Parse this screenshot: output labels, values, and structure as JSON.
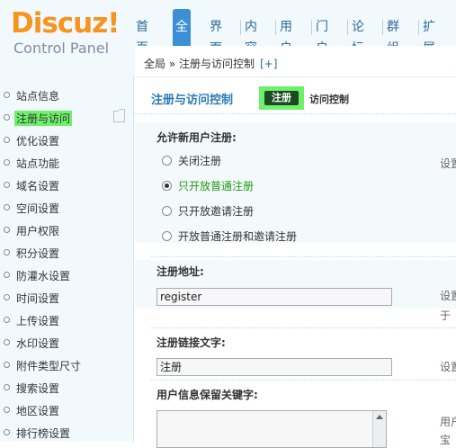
{
  "logo": {
    "main": "Discuz!",
    "sub": "Control Panel"
  },
  "topnav": [
    {
      "label": "首页",
      "active": false
    },
    {
      "label": "全局",
      "active": true
    },
    {
      "label": "界面",
      "active": false
    },
    {
      "label": "内容",
      "active": false
    },
    {
      "label": "用户",
      "active": false
    },
    {
      "label": "门户",
      "active": false
    },
    {
      "label": "论坛",
      "active": false
    },
    {
      "label": "群组",
      "active": false
    },
    {
      "label": "扩展",
      "active": false
    }
  ],
  "breadcrumb": {
    "text": "全局 » 注册与访问控制",
    "plus": "[+]"
  },
  "sidebar": {
    "items": [
      {
        "label": "站点信息"
      },
      {
        "label": "注册与访问",
        "active": true
      },
      {
        "label": "优化设置"
      },
      {
        "label": "站点功能"
      },
      {
        "label": "域名设置"
      },
      {
        "label": "空间设置"
      },
      {
        "label": "用户权限"
      },
      {
        "label": "积分设置"
      },
      {
        "label": "防灌水设置"
      },
      {
        "label": "时间设置"
      },
      {
        "label": "上传设置"
      },
      {
        "label": "水印设置"
      },
      {
        "label": "附件类型尺寸"
      },
      {
        "label": "搜索设置"
      },
      {
        "label": "地区设置"
      },
      {
        "label": "排行榜设置"
      }
    ]
  },
  "subnav": {
    "title": "注册与访问控制",
    "tab_register": "注册",
    "tab_access": "访问控制"
  },
  "form": {
    "allow_register": {
      "title": "允许新用户注册:",
      "options": [
        {
          "label": "关闭注册",
          "checked": false
        },
        {
          "label": "只开放普通注册",
          "checked": true
        },
        {
          "label": "只开放邀请注册",
          "checked": false
        },
        {
          "label": "开放普通注册和邀请注册",
          "checked": false
        }
      ],
      "hint": "设置"
    },
    "register_url": {
      "title": "注册地址:",
      "value": "register",
      "hint1": "设置",
      "hint2": "于"
    },
    "register_link_text": {
      "title": "注册链接文字:",
      "value": "注册",
      "hint": "设置"
    },
    "keep_keywords": {
      "title": "用户信息保留关键字:",
      "hint1": "用户",
      "hint2": "宝"
    }
  }
}
